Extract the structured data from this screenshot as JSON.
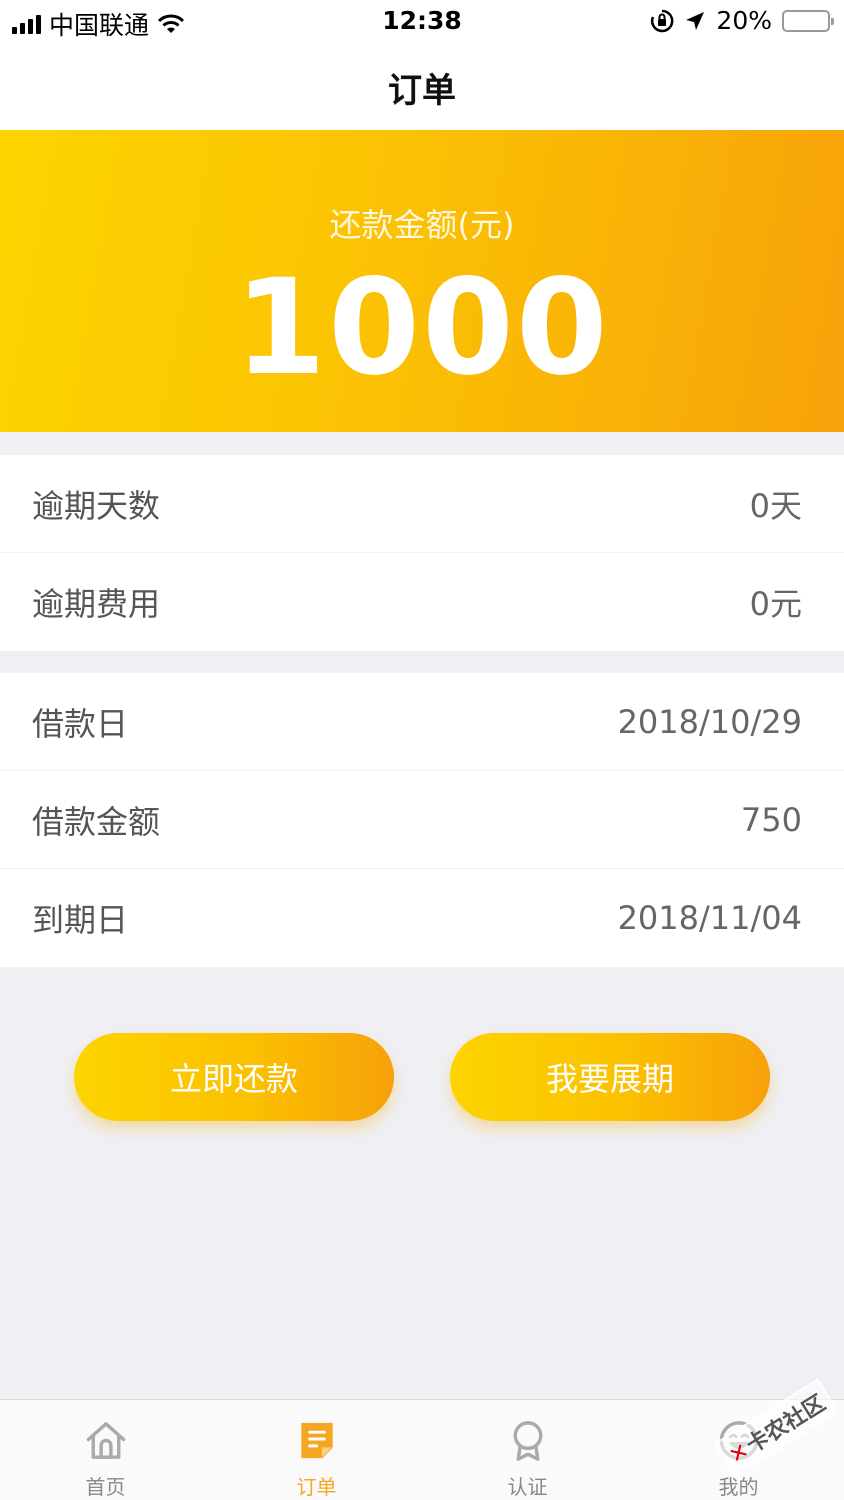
{
  "status_bar": {
    "carrier": "中国联通",
    "time": "12:38",
    "battery": "20%",
    "battery_level": 0.2
  },
  "navbar": {
    "title": "订单"
  },
  "hero": {
    "label": "还款金额(元)",
    "amount": "1000"
  },
  "overdue": {
    "days_label": "逾期天数",
    "days_value": "0天",
    "fee_label": "逾期费用",
    "fee_value": "0元"
  },
  "loan": {
    "date_label": "借款日",
    "date_value": "2018/10/29",
    "amount_label": "借款金额",
    "amount_value": "750",
    "due_label": "到期日",
    "due_value": "2018/11/04"
  },
  "actions": {
    "repay_label": "立即还款",
    "extend_label": "我要展期"
  },
  "tabbar": {
    "items": [
      {
        "label": "首页",
        "icon": "home-icon",
        "active": false
      },
      {
        "label": "订单",
        "icon": "order-icon",
        "active": true
      },
      {
        "label": "认证",
        "icon": "badge-icon",
        "active": false
      },
      {
        "label": "我的",
        "icon": "smiley-icon",
        "active": false
      }
    ]
  },
  "watermark": {
    "text": "卡农社区"
  },
  "colors": {
    "accent": "#f5a623",
    "gradient_start": "#fdd400",
    "gradient_end": "#f7a20a"
  }
}
